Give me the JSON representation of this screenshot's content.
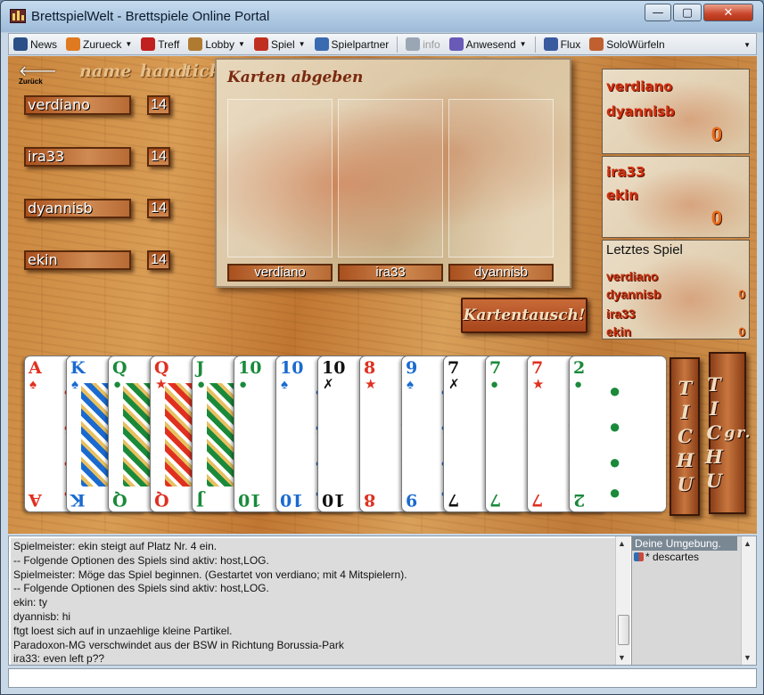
{
  "window": {
    "title": "BrettspielWelt - Brettspiele Online Portal",
    "min": "—",
    "max": "▢",
    "close": "✕"
  },
  "toolbar": {
    "items": [
      {
        "label": "News",
        "color": "#2b4f86",
        "caret": false
      },
      {
        "label": "Zurueck",
        "color": "#e07a20",
        "caret": true
      },
      {
        "label": "Treff",
        "color": "#c02020",
        "caret": false
      },
      {
        "label": "Lobby",
        "color": "#b07a30",
        "caret": true
      },
      {
        "label": "Spiel",
        "color": "#c03020",
        "caret": true
      },
      {
        "label": "Spielpartner",
        "color": "#3a6ab0",
        "caret": false
      },
      {
        "label": "info",
        "color": "#9aa6b4",
        "caret": false
      },
      {
        "label": "Anwesend",
        "color": "#6a5ab8",
        "caret": true
      },
      {
        "label": "Flux",
        "color": "#3a5aa0",
        "caret": false
      },
      {
        "label": "SoloWürfeln",
        "color": "#c06030",
        "caret": false
      }
    ]
  },
  "board": {
    "back_label": "Zurück",
    "columns": [
      "name",
      "hand",
      "tick"
    ],
    "players": [
      {
        "name": "verdiano",
        "hand": "14"
      },
      {
        "name": "ira33",
        "hand": "14"
      },
      {
        "name": "dyannisb",
        "hand": "14"
      },
      {
        "name": "ekin",
        "hand": "14"
      }
    ],
    "exchange": {
      "title": "Karten abgeben",
      "slots": [
        "verdiano",
        "ira33",
        "dyannisb"
      ]
    },
    "kartentausch_label": "Kartentausch!",
    "score_team1": {
      "players": [
        "verdiano",
        "dyannisb"
      ],
      "score": "0"
    },
    "score_team2": {
      "players": [
        "ira33",
        "ekin"
      ],
      "score": "0"
    },
    "last_game": {
      "title": "Letztes Spiel",
      "rows": [
        {
          "name": "verdiano",
          "value": ""
        },
        {
          "name": "dyannisb",
          "value": "0"
        },
        {
          "name": "ira33",
          "value": ""
        },
        {
          "name": "ekin",
          "value": "0"
        }
      ]
    },
    "tichu_label": "TICHU",
    "grand_tichu_prefix": "gr.",
    "grand_tichu_label": "TICHU"
  },
  "hand_cards": [
    {
      "rank": "A",
      "suit": "spade",
      "color": "#e03020",
      "face": false
    },
    {
      "rank": "K",
      "suit": "pagoda",
      "color": "#1a6ad0",
      "face": true
    },
    {
      "rank": "Q",
      "suit": "jade",
      "color": "#1a8a3a",
      "face": true
    },
    {
      "rank": "Q",
      "suit": "star",
      "color": "#e03020",
      "face": true
    },
    {
      "rank": "J",
      "suit": "jade",
      "color": "#1a8a3a",
      "face": true
    },
    {
      "rank": "10",
      "suit": "jade",
      "color": "#1a8a3a",
      "face": false
    },
    {
      "rank": "10",
      "suit": "pagoda",
      "color": "#1a6ad0",
      "face": false
    },
    {
      "rank": "10",
      "suit": "sword",
      "color": "#111111",
      "face": false
    },
    {
      "rank": "8",
      "suit": "star",
      "color": "#e03020",
      "face": false
    },
    {
      "rank": "9",
      "suit": "pagoda",
      "color": "#1a6ad0",
      "face": false
    },
    {
      "rank": "7",
      "suit": "sword",
      "color": "#111111",
      "face": false
    },
    {
      "rank": "7",
      "suit": "jade",
      "color": "#1a8a3a",
      "face": false
    },
    {
      "rank": "7",
      "suit": "star",
      "color": "#e03020",
      "face": false
    },
    {
      "rank": "2",
      "suit": "jade",
      "color": "#1a8a3a",
      "face": false
    }
  ],
  "chat": {
    "lines": [
      "Spielmeister: ekin steigt auf Platz Nr. 4 ein.",
      "-- Folgende Optionen des Spiels sind aktiv: host,LOG.",
      "Spielmeister: Möge das Spiel beginnen. (Gestartet von verdiano; mit 4 Mitspielern).",
      "-- Folgende Optionen des Spiels sind aktiv: host,LOG.",
      "ekin: ty",
      "dyannisb: hi",
      "ftgt loest sich auf in unzaehlige kleine Partikel.",
      "Paradoxon-MG verschwindet aus der BSW in Richtung Borussia-Park",
      "ira33: even left p??"
    ],
    "environment_title": "Deine Umgebung.",
    "environment_users": [
      "* descartes"
    ]
  },
  "input": {
    "value": ""
  }
}
